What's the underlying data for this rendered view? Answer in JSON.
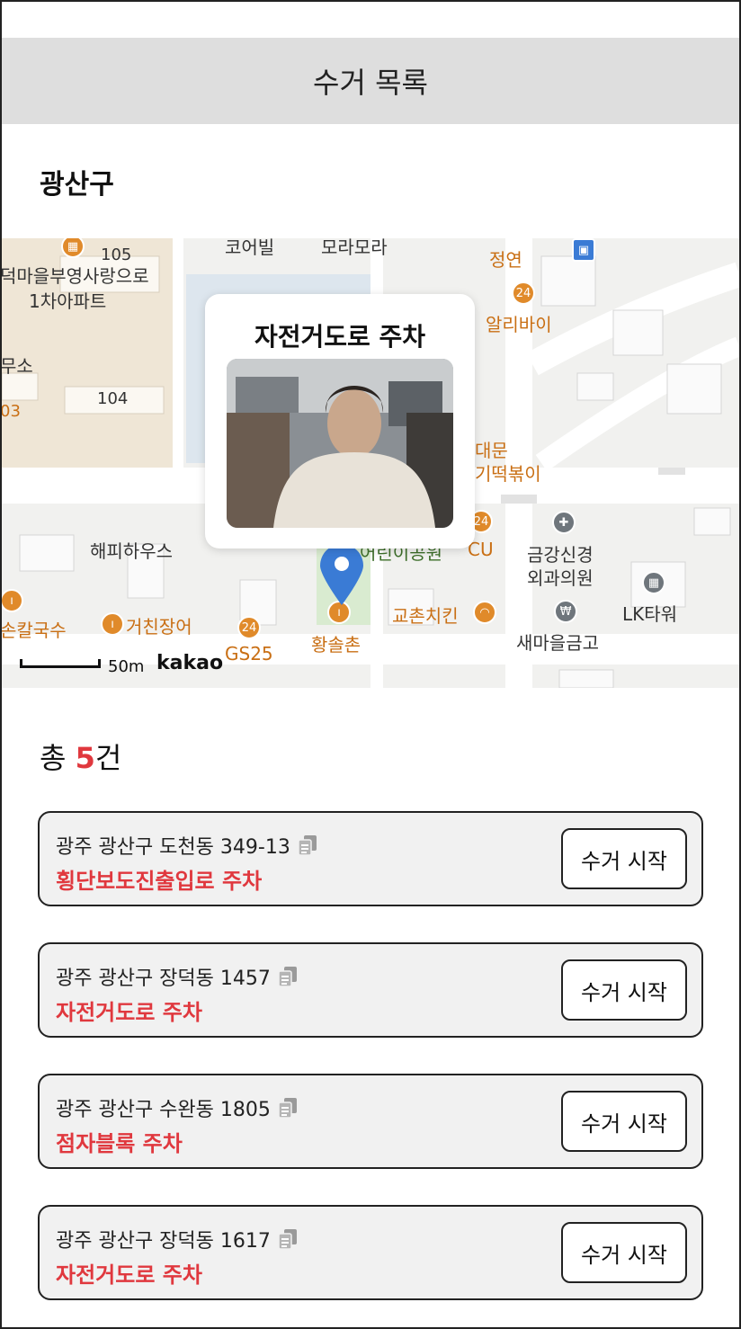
{
  "header": {
    "title": "수거 목록"
  },
  "district": "광산구",
  "map": {
    "popup_title": "자전거도로 주차",
    "scale_label": "50m",
    "brand": "kakao",
    "labels": [
      "코어빌",
      "모라모라",
      "정연",
      "105",
      "덕마을부영사랑으로",
      "1차아파트",
      "알리바이",
      "무소",
      "104",
      "03",
      "대문",
      "기떡볶이",
      "해피하우스",
      "금강신경",
      "외과의원",
      "CU",
      "어린이공원",
      "LK타워",
      "손칼국수",
      "거친장어",
      "황솔촌",
      "교촌치킨",
      "새마을금고",
      "GS25"
    ]
  },
  "summary": {
    "prefix": "총 ",
    "count": "5",
    "suffix": "건"
  },
  "items": [
    {
      "address": "광주 광산구 도천동 349-13",
      "reason": "횡단보도진출입로 주차",
      "button": "수거 시작"
    },
    {
      "address": "광주 광산구 장덕동 1457",
      "reason": "자전거도로 주차",
      "button": "수거 시작"
    },
    {
      "address": "광주 광산구 수완동 1805",
      "reason": "점자블록 주차",
      "button": "수거 시작"
    },
    {
      "address": "광주 광산구 장덕동 1617",
      "reason": "자전거도로 주차",
      "button": "수거 시작"
    }
  ],
  "icons": {
    "copy": "copy-icon",
    "map_pin": "map-pin-icon"
  },
  "colors": {
    "accent_red": "#e0383e",
    "header_bg": "#dedede",
    "pin_blue": "#3a7bd5"
  }
}
